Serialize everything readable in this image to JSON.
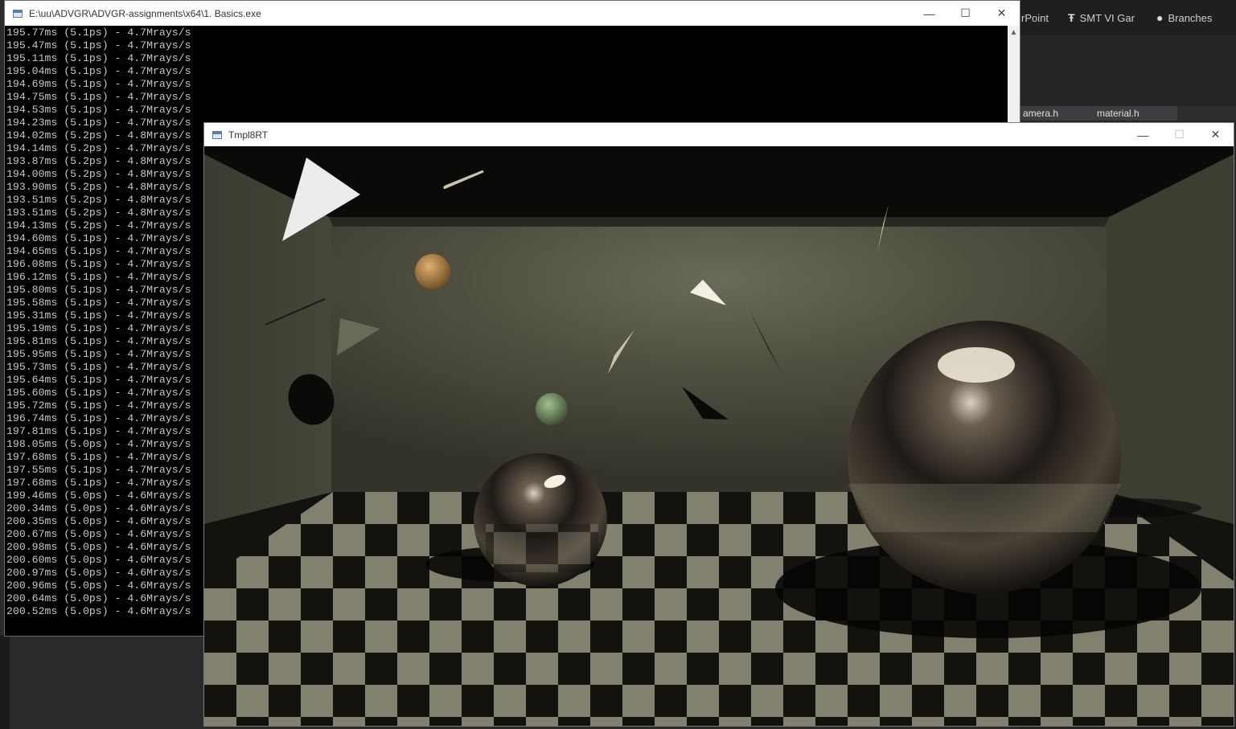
{
  "background_app": {
    "tabs": [
      {
        "label": "rPoint",
        "icon": "powerpoint-icon"
      },
      {
        "label": "SMT VI Gar",
        "icon": "tool-icon"
      },
      {
        "label": "Branches",
        "icon": "github-icon"
      }
    ],
    "file_tabs": [
      "amera.h",
      "material.h"
    ]
  },
  "console_window": {
    "title": "E:\\uu\\ADVGR\\ADVGR-assignments\\x64\\1. Basics.exe",
    "minimize": "—",
    "maximize": "☐",
    "close": "✕",
    "lines": [
      "195.77ms (5.1ps) - 4.7Mrays/s",
      "195.47ms (5.1ps) - 4.7Mrays/s",
      "195.11ms (5.1ps) - 4.7Mrays/s",
      "195.04ms (5.1ps) - 4.7Mrays/s",
      "194.69ms (5.1ps) - 4.7Mrays/s",
      "194.75ms (5.1ps) - 4.7Mrays/s",
      "194.53ms (5.1ps) - 4.7Mrays/s",
      "194.23ms (5.1ps) - 4.7Mrays/s",
      "194.02ms (5.2ps) - 4.8Mrays/s",
      "194.14ms (5.2ps) - 4.7Mrays/s",
      "193.87ms (5.2ps) - 4.8Mrays/s",
      "194.00ms (5.2ps) - 4.8Mrays/s",
      "193.90ms (5.2ps) - 4.8Mrays/s",
      "193.51ms (5.2ps) - 4.8Mrays/s",
      "193.51ms (5.2ps) - 4.8Mrays/s",
      "194.13ms (5.2ps) - 4.7Mrays/s",
      "194.60ms (5.1ps) - 4.7Mrays/s",
      "194.65ms (5.1ps) - 4.7Mrays/s",
      "196.08ms (5.1ps) - 4.7Mrays/s",
      "196.12ms (5.1ps) - 4.7Mrays/s",
      "195.80ms (5.1ps) - 4.7Mrays/s",
      "195.58ms (5.1ps) - 4.7Mrays/s",
      "195.31ms (5.1ps) - 4.7Mrays/s",
      "195.19ms (5.1ps) - 4.7Mrays/s",
      "195.81ms (5.1ps) - 4.7Mrays/s",
      "195.95ms (5.1ps) - 4.7Mrays/s",
      "195.73ms (5.1ps) - 4.7Mrays/s",
      "195.64ms (5.1ps) - 4.7Mrays/s",
      "195.60ms (5.1ps) - 4.7Mrays/s",
      "195.72ms (5.1ps) - 4.7Mrays/s",
      "196.74ms (5.1ps) - 4.7Mrays/s",
      "197.81ms (5.1ps) - 4.7Mrays/s",
      "198.05ms (5.0ps) - 4.7Mrays/s",
      "197.68ms (5.1ps) - 4.7Mrays/s",
      "197.55ms (5.1ps) - 4.7Mrays/s",
      "197.68ms (5.1ps) - 4.7Mrays/s",
      "199.46ms (5.0ps) - 4.6Mrays/s",
      "200.34ms (5.0ps) - 4.6Mrays/s",
      "200.35ms (5.0ps) - 4.6Mrays/s",
      "200.67ms (5.0ps) - 4.6Mrays/s",
      "200.98ms (5.0ps) - 4.6Mrays/s",
      "200.60ms (5.0ps) - 4.6Mrays/s",
      "200.97ms (5.0ps) - 4.6Mrays/s",
      "200.96ms (5.0ps) - 4.6Mrays/s",
      "200.64ms (5.0ps) - 4.6Mrays/s",
      "200.52ms (5.0ps) - 4.6Mrays/s"
    ]
  },
  "render_window": {
    "title": "Tmpl8RT",
    "minimize": "—",
    "maximize": "☐",
    "close": "✕"
  },
  "colors": {
    "console_text": "#c8c8c8",
    "console_bg": "#000000",
    "floor_light": "#8c8c78",
    "floor_dark": "#141410",
    "wall": "#4a4a3c"
  }
}
